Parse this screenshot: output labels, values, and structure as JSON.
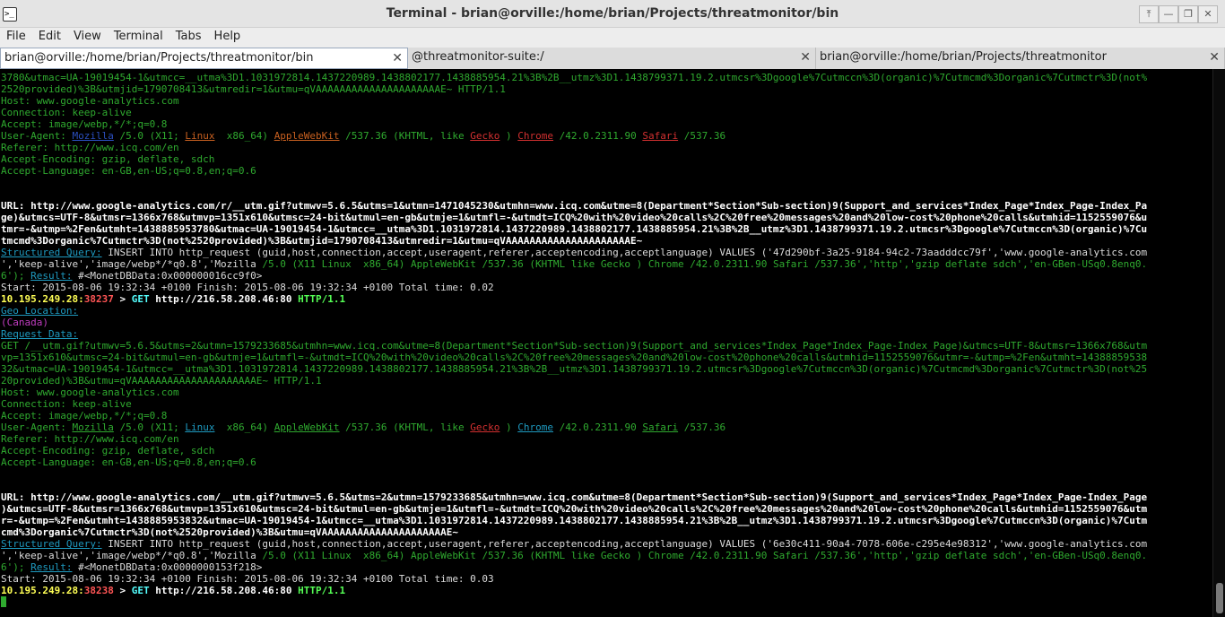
{
  "window": {
    "icon_label": ">_",
    "title": "Terminal - brian@orville:/home/brian/Projects/threatmonitor/bin",
    "buttons": [
      "⤒",
      "—",
      "❐",
      "✕"
    ]
  },
  "menu": [
    "File",
    "Edit",
    "View",
    "Terminal",
    "Tabs",
    "Help"
  ],
  "tabs": [
    {
      "label": "brian@orville:/home/brian/Projects/threatmonitor/bin",
      "close": "✕"
    },
    {
      "label": "@threatmonitor-suite:/",
      "close": "✕"
    },
    {
      "label": "brian@orville:/home/brian/Projects/threatmonitor",
      "close": "✕"
    }
  ],
  "terminal_lines": [
    [
      {
        "t": "3780&utmac=UA-19019454-1&utmcc=__utma%3D1.1031972814.1437220989.1438802177.1438885954.21%3B%2B__utmz%3D1.1438799371.19.2.utmcsr%3Dgoogle%7Cutmccn%3D(organic)%7Cutmcmd%3Dorganic%7Cutmctr%3D(not%"
      }
    ],
    [
      {
        "t": "2520provided)%3B&utmjid=1790708413&utmredir=1&utmu=qVAAAAAAAAAAAAAAAAAAAAAE~ HTTP/1.1"
      }
    ],
    [
      {
        "t": "Host: www.google-analytics.com"
      }
    ],
    [
      {
        "t": "Connection: keep-alive"
      }
    ],
    [
      {
        "t": "Accept: image/webp,*/*;q=0.8"
      }
    ],
    [
      {
        "t": "User-Agent: "
      },
      {
        "t": "Mozilla",
        "c": "blue-u"
      },
      {
        "t": " /5.0 (X11; "
      },
      {
        "t": "Linux",
        "c": "ora-u"
      },
      {
        "t": "  x86_64) "
      },
      {
        "t": "AppleWebKit",
        "c": "ora-u"
      },
      {
        "t": " /537.36 (KHTML, like "
      },
      {
        "t": "Gecko",
        "c": "red-u"
      },
      {
        "t": " ) "
      },
      {
        "t": "Chrome",
        "c": "red-u"
      },
      {
        "t": " /42.0.2311.90 "
      },
      {
        "t": "Safari",
        "c": "red-u"
      },
      {
        "t": " /537.36"
      }
    ],
    [
      {
        "t": "Referer: http://www.icq.com/en"
      }
    ],
    [
      {
        "t": "Accept-Encoding: gzip, deflate, sdch"
      }
    ],
    [
      {
        "t": "Accept-Language: en-GB,en-US;q=0.8,en;q=0.6"
      }
    ],
    [
      {
        "t": ""
      }
    ],
    [
      {
        "t": ""
      }
    ],
    [
      {
        "t": "URL: http://www.google-analytics.com/r/__utm.gif?utmwv=5.6.5&utms=1&utmn=1471045230&utmhn=www.icq.com&utme=8(Department*Section*Sub-section)9(Support_and_services*Index_Page*Index_Page-Index_Pa",
        "c": "bw"
      }
    ],
    [
      {
        "t": "ge)&utmcs=UTF-8&utmsr=1366x768&utmvp=1351x610&utmsc=24-bit&utmul=en-gb&utmje=1&utmfl=-&utmdt=ICQ%20with%20video%20calls%2C%20free%20messages%20and%20low-cost%20phone%20calls&utmhid=1152559076&u",
        "c": "bw"
      }
    ],
    [
      {
        "t": "tmr=-&utmp=%2Fen&utmht=1438885953780&utmac=UA-19019454-1&utmcc=__utma%3D1.1031972814.1437220989.1438802177.1438885954.21%3B%2B__utmz%3D1.1438799371.19.2.utmcsr%3Dgoogle%7Cutmccn%3D(organic)%7Cu",
        "c": "bw"
      }
    ],
    [
      {
        "t": "tmcmd%3Dorganic%7Cutmctr%3D(not%2520provided)%3B&utmjid=1790708413&utmredir=1&utmu=qVAAAAAAAAAAAAAAAAAAAAAE~",
        "c": "bw"
      }
    ],
    [
      {
        "t": "Structured Query:",
        "c": "cu"
      },
      {
        "t": " INSERT INTO http_request (guid,host,connection,accept,useragent,referer,acceptencoding,acceptlanguage) VALUES ('47d290bf-3a25-9184-94c2-73aadddcc79f','www.google-analytics.com",
        "c": "w"
      }
    ],
    [
      {
        "t": "','keep-alive','image/webp*/*q0.8','Mozilla",
        "c": "w"
      },
      {
        "t": " /5.0 (X11 Linux  x86_64) AppleWebKit /537.36 (KHTML like Gecko ) Chrome /42.0.2311.90 Safari /537.36','http','gzip deflate sdch','en-GBen-USq0.8enq0."
      }
    ],
    [
      {
        "t": "6'); "
      },
      {
        "t": "Result:",
        "c": "cu"
      },
      {
        "t": " #<MonetDBData:0x000000016cc9f0>",
        "c": "w"
      }
    ],
    [
      {
        "t": "Start: 2015-08-06 19:32:34 +0100 Finish: 2015-08-06 19:32:34 +0100 Total time: 0.02",
        "c": "w"
      }
    ],
    [
      {
        "t": "10.195.249.28:",
        "c": "y"
      },
      {
        "t": "38237",
        "c": "r"
      },
      {
        "t": " > ",
        "c": "bw"
      },
      {
        "t": "GET",
        "c": "cy"
      },
      {
        "t": " http://216.58.208.46:80",
        "c": "bw"
      },
      {
        "t": " HTTP/1.1",
        "c": "gb"
      }
    ],
    [
      {
        "t": "Geo Location:",
        "c": "cu"
      }
    ],
    [
      {
        "t": "(Canada)",
        "c": "mag"
      }
    ],
    [
      {
        "t": "Request Data:",
        "c": "cu"
      }
    ],
    [
      {
        "t": "GET /__utm.gif?utmwv=5.6.5&utms=2&utmn=1579233685&utmhn=www.icq.com&utme=8(Department*Section*Sub-section)9(Support_and_services*Index_Page*Index_Page-Index_Page)&utmcs=UTF-8&utmsr=1366x768&utm"
      }
    ],
    [
      {
        "t": "vp=1351x610&utmsc=24-bit&utmul=en-gb&utmje=1&utmfl=-&utmdt=ICQ%20with%20video%20calls%2C%20free%20messages%20and%20low-cost%20phone%20calls&utmhid=1152559076&utmr=-&utmp=%2Fen&utmht=14388859538"
      }
    ],
    [
      {
        "t": "32&utmac=UA-19019454-1&utmcc=__utma%3D1.1031972814.1437220989.1438802177.1438885954.21%3B%2B__utmz%3D1.1438799371.19.2.utmcsr%3Dgoogle%7Cutmccn%3D(organic)%7Cutmcmd%3Dorganic%7Cutmctr%3D(not%25"
      }
    ],
    [
      {
        "t": "20provided)%3B&utmu=qVAAAAAAAAAAAAAAAAAAAAAE~ HTTP/1.1"
      }
    ],
    [
      {
        "t": "Host: www.google-analytics.com"
      }
    ],
    [
      {
        "t": "Connection: keep-alive"
      }
    ],
    [
      {
        "t": "Accept: image/webp,*/*;q=0.8"
      }
    ],
    [
      {
        "t": "User-Agent: "
      },
      {
        "t": "Mozilla",
        "c": "u"
      },
      {
        "t": " /5.0 (X11; "
      },
      {
        "t": "Linux",
        "c": "cu"
      },
      {
        "t": "  x86_64) "
      },
      {
        "t": "AppleWebKit",
        "c": "u"
      },
      {
        "t": " /537.36 (KHTML, like "
      },
      {
        "t": "Gecko",
        "c": "red-u"
      },
      {
        "t": " ) "
      },
      {
        "t": "Chrome",
        "c": "cu"
      },
      {
        "t": " /42.0.2311.90 "
      },
      {
        "t": "Safari",
        "c": "u"
      },
      {
        "t": " /537.36"
      }
    ],
    [
      {
        "t": "Referer: http://www.icq.com/en"
      }
    ],
    [
      {
        "t": "Accept-Encoding: gzip, deflate, sdch"
      }
    ],
    [
      {
        "t": "Accept-Language: en-GB,en-US;q=0.8,en;q=0.6"
      }
    ],
    [
      {
        "t": ""
      }
    ],
    [
      {
        "t": ""
      }
    ],
    [
      {
        "t": "URL: http://www.google-analytics.com/__utm.gif?utmwv=5.6.5&utms=2&utmn=1579233685&utmhn=www.icq.com&utme=8(Department*Section*Sub-section)9(Support_and_services*Index_Page*Index_Page-Index_Page",
        "c": "bw"
      }
    ],
    [
      {
        "t": ")&utmcs=UTF-8&utmsr=1366x768&utmvp=1351x610&utmsc=24-bit&utmul=en-gb&utmje=1&utmfl=-&utmdt=ICQ%20with%20video%20calls%2C%20free%20messages%20and%20low-cost%20phone%20calls&utmhid=1152559076&utm",
        "c": "bw"
      }
    ],
    [
      {
        "t": "r=-&utmp=%2Fen&utmht=1438885953832&utmac=UA-19019454-1&utmcc=__utma%3D1.1031972814.1437220989.1438802177.1438885954.21%3B%2B__utmz%3D1.1438799371.19.2.utmcsr%3Dgoogle%7Cutmccn%3D(organic)%7Cutm",
        "c": "bw"
      }
    ],
    [
      {
        "t": "cmd%3Dorganic%7Cutmctr%3D(not%2520provided)%3B&utmu=qVAAAAAAAAAAAAAAAAAAAAAE~",
        "c": "bw"
      }
    ],
    [
      {
        "t": "Structured Query:",
        "c": "cu"
      },
      {
        "t": " INSERT INTO http_request (guid,host,connection,accept,useragent,referer,acceptencoding,acceptlanguage) VALUES ('6e30c411-90a4-7078-606e-c295e4e98312','www.google-analytics.com",
        "c": "w"
      }
    ],
    [
      {
        "t": "','keep-alive','image/webp*/*q0.8','Mozilla",
        "c": "w"
      },
      {
        "t": " /5.0 (X11 Linux  x86_64) AppleWebKit /537.36 (KHTML like Gecko ) Chrome /42.0.2311.90 Safari /537.36','http','gzip deflate sdch','en-GBen-USq0.8enq0."
      }
    ],
    [
      {
        "t": "6'); "
      },
      {
        "t": "Result:",
        "c": "cu"
      },
      {
        "t": " #<MonetDBData:0x0000000153f218>",
        "c": "w"
      }
    ],
    [
      {
        "t": "Start: 2015-08-06 19:32:34 +0100 Finish: 2015-08-06 19:32:34 +0100 Total time: 0.03",
        "c": "w"
      }
    ],
    [
      {
        "t": "10.195.249.28:",
        "c": "y"
      },
      {
        "t": "38238",
        "c": "r"
      },
      {
        "t": " > ",
        "c": "bw"
      },
      {
        "t": "GET",
        "c": "cy"
      },
      {
        "t": " http://216.58.208.46:80",
        "c": "bw"
      },
      {
        "t": " HTTP/1.1",
        "c": "gb"
      }
    ]
  ],
  "colors": {
    "terminal_bg": "#000000",
    "terminal_fg": "#2faa2f",
    "titlebar_bg": "#e4e4e4"
  }
}
